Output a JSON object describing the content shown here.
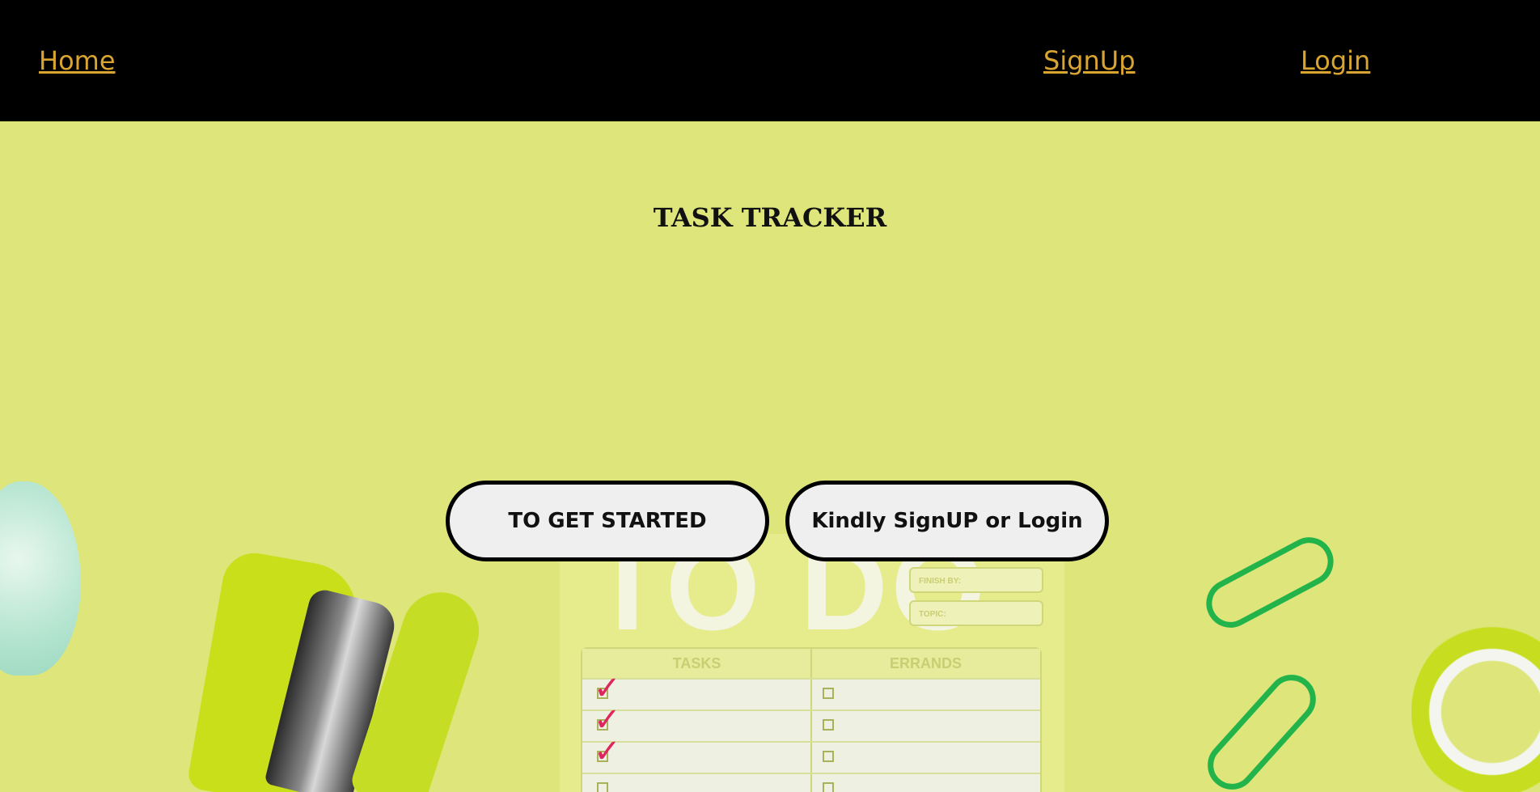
{
  "nav": {
    "home": "Home",
    "signup": "SignUp",
    "login": "Login"
  },
  "hero": {
    "title": "TASK TRACKER",
    "get_started_label": "TO GET STARTED",
    "signup_login_label": "Kindly SignUP or Login"
  },
  "illustration": {
    "todo_heading": "TO DO",
    "finish_by_label": "FINISH BY:",
    "topic_label": "TOPIC:",
    "tasks_header": "TASKS",
    "errands_header": "ERRANDS"
  },
  "colors": {
    "nav_background": "#000000",
    "nav_link": "#d9a530",
    "hero_background": "#dde57b",
    "button_background": "#efefef"
  }
}
